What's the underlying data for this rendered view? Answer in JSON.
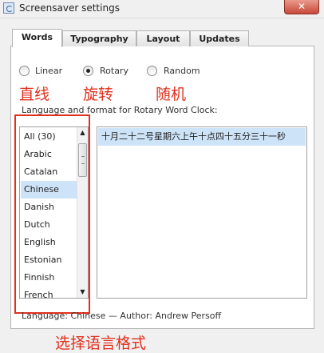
{
  "window": {
    "title": "Screensaver settings",
    "close_glyph": "✕"
  },
  "tabs": [
    {
      "label": "Words",
      "active": true
    },
    {
      "label": "Typography",
      "active": false
    },
    {
      "label": "Layout",
      "active": false
    },
    {
      "label": "Updates",
      "active": false
    }
  ],
  "radios": [
    {
      "label": "Linear",
      "checked": false
    },
    {
      "label": "Rotary",
      "checked": true
    },
    {
      "label": "Random",
      "checked": false
    }
  ],
  "annotations": {
    "linear": "直线",
    "rotary": "旋转",
    "random": "随机",
    "language_format": "选择语言格式"
  },
  "description": "Language and format for Rotary Word Clock:",
  "language_list": {
    "items": [
      "All (30)",
      "Arabic",
      "Catalan",
      "Chinese",
      "Danish",
      "Dutch",
      "English",
      "Estonian",
      "Finnish",
      "French"
    ],
    "selected": "Chinese"
  },
  "preview": {
    "text": "十月二十二号星期六上午十点四十五分三十一秒"
  },
  "status": "Language: Chinese — Author: Andrew Persoff",
  "colors": {
    "accent_red": "#e0301e",
    "selection": "#cde3f7"
  }
}
